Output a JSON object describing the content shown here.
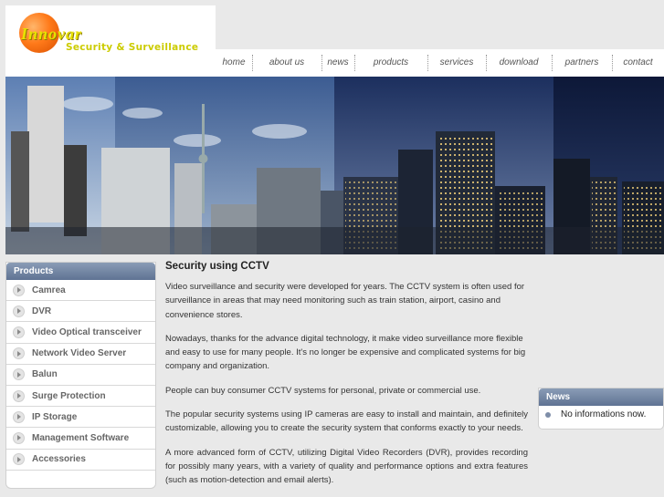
{
  "brand": {
    "name": "Innovar",
    "tagline": "Security & Surveillance"
  },
  "nav": {
    "items": [
      {
        "label": "home"
      },
      {
        "label": "about us"
      },
      {
        "label": "news"
      },
      {
        "label": "products"
      },
      {
        "label": "services"
      },
      {
        "label": "download"
      },
      {
        "label": "partners"
      },
      {
        "label": "contact"
      }
    ]
  },
  "sidebar": {
    "title": "Products",
    "items": [
      {
        "label": "Camrea"
      },
      {
        "label": "DVR"
      },
      {
        "label": "Video Optical transceiver"
      },
      {
        "label": "Network Video Server"
      },
      {
        "label": "Balun"
      },
      {
        "label": "Surge Protection"
      },
      {
        "label": "IP Storage"
      },
      {
        "label": "Management Software"
      },
      {
        "label": "Accessories"
      }
    ]
  },
  "content": {
    "title": "Security using CCTV",
    "paragraphs": [
      "Video surveillance and security were developed for years. The CCTV system is often used for surveillance in areas that may need monitoring such as train station, airport, casino and convenience stores.",
      "Nowadays, thanks for the advance digital technology, it make video surveillance more flexible and easy to use for many people. It's no longer be expensive and complicated systems for big company and organization.",
      "People can buy consumer CCTV systems for personal, private or commercial use.",
      "The popular security systems using IP cameras are easy to install and maintain, and definitely customizable, allowing you to create the security system that conforms exactly to your needs.",
      "A more advanced form of CCTV, utilizing Digital Video Recorders (DVR), provides recording for possibly many years, with a variety of quality and performance options and extra features (such as motion-detection and email alerts)."
    ]
  },
  "news": {
    "title": "News",
    "items": [
      {
        "text": "No informations now."
      }
    ]
  },
  "colors": {
    "accent": "#6c7f9c",
    "logo_orange": "#ff7a1a",
    "logo_yellow": "#cccc00"
  }
}
